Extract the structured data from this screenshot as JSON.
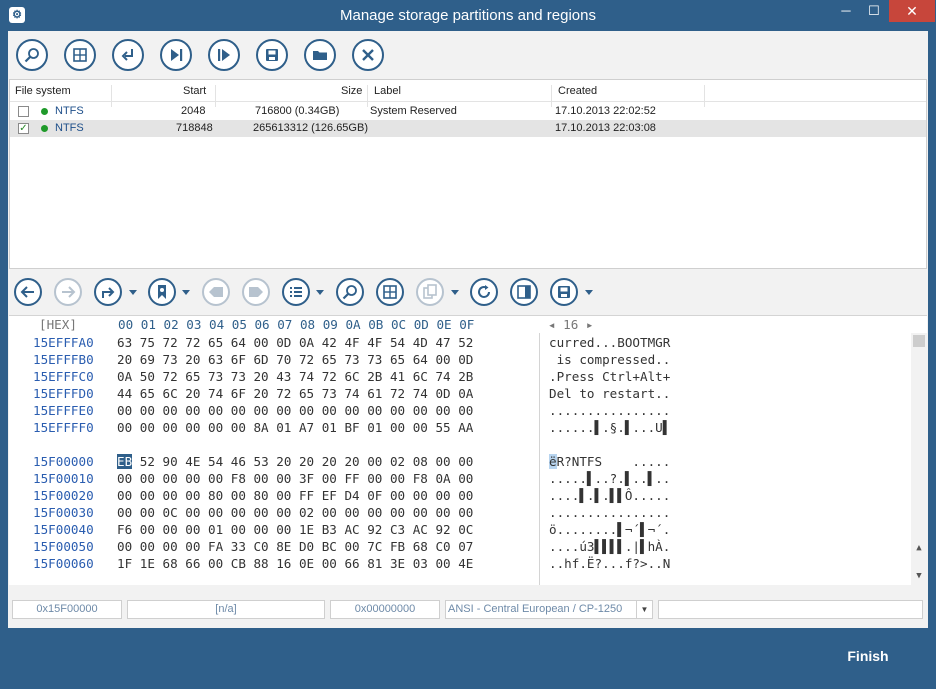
{
  "window": {
    "title": "Manage storage partitions and regions",
    "app_icon": "gear-icon",
    "minimize": "─",
    "maximize": "☐",
    "close": "✕"
  },
  "partition_list": {
    "columns": [
      "File system",
      "Start",
      "Size",
      "Label",
      "Created"
    ],
    "rows": [
      {
        "checked": false,
        "filesystem": "NTFS",
        "start": "2048",
        "size": "716800 (0.34GB)",
        "label": "System Reserved",
        "created": "17.10.2013 22:02:52"
      },
      {
        "checked": true,
        "filesystem": "NTFS",
        "start": "718848",
        "size": "265613312 (126.65GB)",
        "label": "",
        "created": "17.10.2013 22:03:08"
      }
    ]
  },
  "hex": {
    "header_label": "[HEX]",
    "columns": "00 01 02 03 04 05 06 07 08 09 0A 0B 0C 0D 0E 0F",
    "page_nav": "◂ 16 ▸",
    "lines": [
      {
        "addr": "15EFFFA0",
        "bytes": "63 75 72 72 65 64 00 0D 0A 42 4F 4F 54 4D 47 52",
        "ascii": "curred...BOOTMGR"
      },
      {
        "addr": "15EFFFB0",
        "bytes": "20 69 73 20 63 6F 6D 70 72 65 73 73 65 64 00 0D",
        "ascii": " is compressed.."
      },
      {
        "addr": "15EFFFC0",
        "bytes": "0A 50 72 65 73 73 20 43 74 72 6C 2B 41 6C 74 2B",
        "ascii": ".Press Ctrl+Alt+"
      },
      {
        "addr": "15EFFFD0",
        "bytes": "44 65 6C 20 74 6F 20 72 65 73 74 61 72 74 0D 0A",
        "ascii": "Del to restart.."
      },
      {
        "addr": "15EFFFE0",
        "bytes": "00 00 00 00 00 00 00 00 00 00 00 00 00 00 00 00",
        "ascii": "................"
      },
      {
        "addr": "15EFFFF0",
        "bytes": "00 00 00 00 00 00 8A 01 A7 01 BF 01 00 00 55 AA",
        "ascii": "......▌.§.▌...U▌"
      },
      {
        "addr": "15F00000",
        "first_byte": "EB",
        "bytes": " 52 90 4E 54 46 53 20 20 20 20 00 02 08 00 00",
        "first_char": "ë",
        "ascii": "R?NTFS    ....."
      },
      {
        "addr": "15F00010",
        "bytes": "00 00 00 00 00 F8 00 00 3F 00 FF 00 00 F8 0A 00",
        "ascii": ".....▌..?.▌..▌.."
      },
      {
        "addr": "15F00020",
        "bytes": "00 00 00 00 80 00 80 00 FF EF D4 0F 00 00 00 00",
        "ascii": "....▌.▌.▌▌Ô....."
      },
      {
        "addr": "15F00030",
        "bytes": "00 00 0C 00 00 00 00 00 02 00 00 00 00 00 00 00",
        "ascii": "................"
      },
      {
        "addr": "15F00040",
        "bytes": "F6 00 00 00 01 00 00 00 1E B3 AC 92 C3 AC 92 0C",
        "ascii": "ö........▌¬´▌¬´."
      },
      {
        "addr": "15F00050",
        "bytes": "00 00 00 00 FA 33 C0 8E D0 BC 00 7C FB 68 C0 07",
        "ascii": "....ú3▌▌▌▌.|▌hÀ."
      },
      {
        "addr": "15F00060",
        "bytes": "1F 1E 68 66 00 CB 88 16 0E 00 66 81 3E 03 00 4E",
        "ascii": "..hf.Ë?...f?>..N"
      }
    ]
  },
  "statusbar": {
    "offset": "0x15F00000",
    "value": "[n/a]",
    "position": "0x00000000",
    "encoding": "ANSI - Central European / CP-1250",
    "extra": ""
  },
  "footer": {
    "finish_label": "Finish"
  },
  "colors": {
    "accent": "#2f5f8a",
    "close": "#c7463b",
    "ntfs_dot": "#1f9a2a"
  }
}
